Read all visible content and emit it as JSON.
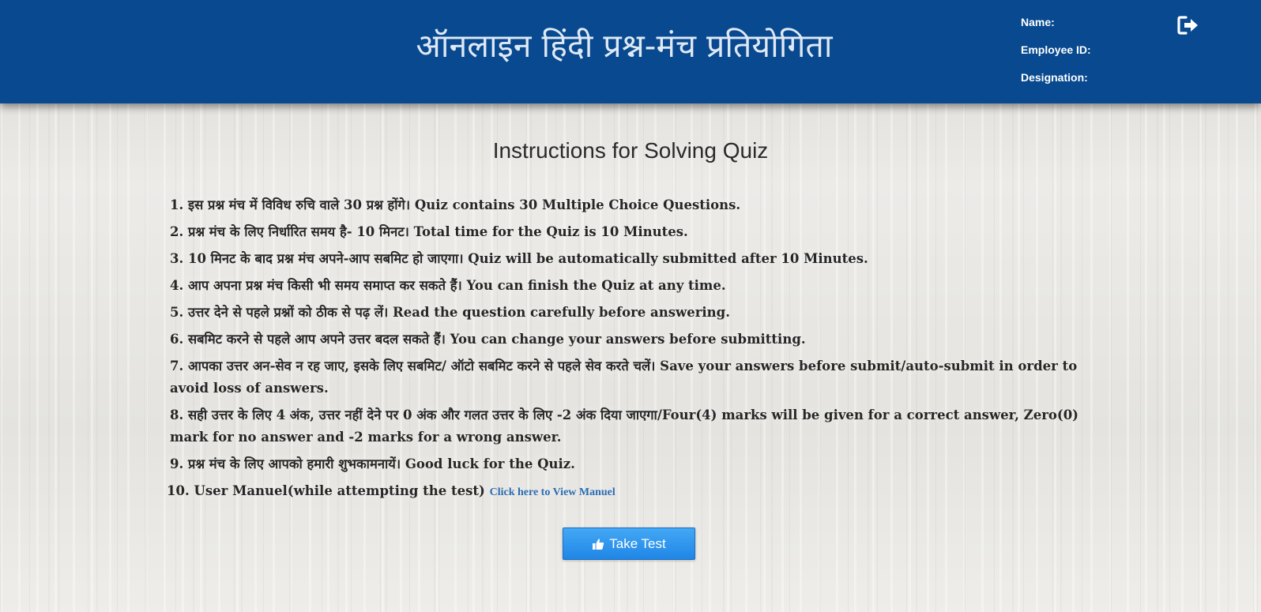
{
  "header": {
    "title": "ऑनलाइन हिंदी प्रश्न-मंच प्रतियोगिता",
    "user": {
      "name_label": "Name:",
      "name_value": "",
      "employee_id_label": "Employee ID:",
      "employee_id_value": "",
      "designation_label": "Designation:",
      "designation_value": ""
    },
    "logout_icon": "sign-out-icon"
  },
  "main": {
    "heading": "Instructions for Solving Quiz",
    "instructions": [
      "1. इस प्रश्न मंच में विविध रुचि वाले 30 प्रश्न होंगे। Quiz contains 30 Multiple Choice Questions.",
      "2. प्रश्न मंच के लिए निर्धारित समय है- 10 मिनट। Total time for the Quiz is 10 Minutes.",
      "3. 10 मिनट के बाद प्रश्न मंच अपने-आप सबमिट हो जाएगा। Quiz will be automatically submitted after 10 Minutes.",
      "4. आप अपना प्रश्न मंच किसी भी समय समाप्त कर सकते हैं। You can finish the Quiz at any time.",
      "5. उत्तर देने से पहले प्रश्नों को ठीक से पढ़ लें। Read the question carefully before answering.",
      "6. सबमिट करने से पहले आप अपने उत्तर बदल सकते हैं। You can change your answers before submitting.",
      "7. आपका उत्तर अन-सेव न रह जाए, इसके लिए सबमिट/ ऑटो सबमिट करने से पहले सेव करते चलें। Save your answers before submit/auto-submit in order to avoid loss of answers.",
      "8. सही उत्तर के लिए 4 अंक, उत्तर नहीं देने पर 0 अंक और गलत उत्तर के लिए -2 अंक दिया जाएगा/Four(4) marks will be given for a correct answer, Zero(0) mark for no answer and -2 marks for a wrong answer.",
      "9. प्रश्न मंच के लिए आपको हमारी शुभकामनायें। Good luck for the Quiz."
    ],
    "manual_item_text": "10. User Manuel(while attempting the test) ",
    "manual_link": "Click here to View Manuel",
    "take_test_label": "Take Test",
    "take_test_icon": "thumbs-up-icon"
  },
  "colors": {
    "header_bg": "#08498f",
    "button_bg": "#2b95ec",
    "link": "#2b6cb3"
  }
}
